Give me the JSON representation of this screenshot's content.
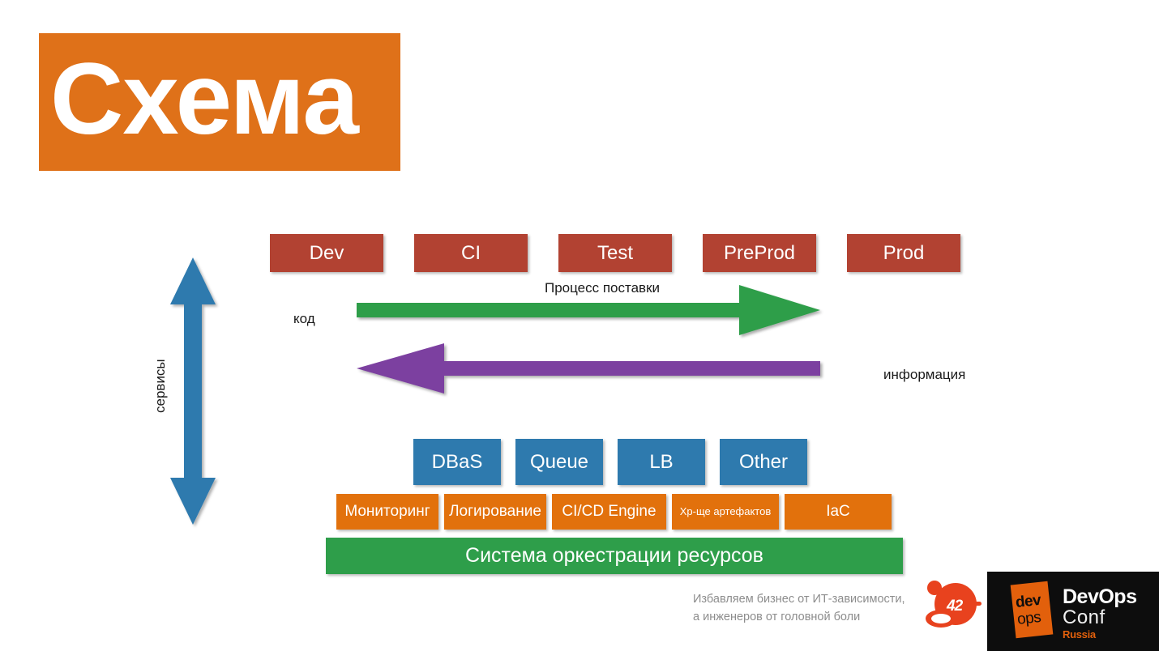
{
  "slide": {
    "title": "Схема",
    "title_bg": "#DF7119"
  },
  "pipeline": {
    "label_process": "Процесс поставки",
    "label_code": "код",
    "label_info": "информация",
    "label_services": "сервисы",
    "stages": [
      {
        "label": "Dev"
      },
      {
        "label": "CI"
      },
      {
        "label": "Test"
      },
      {
        "label": "PreProd"
      },
      {
        "label": "Prod"
      }
    ],
    "stage_color": "#B24232",
    "arrow_forward_color": "#2E9E4A",
    "arrow_backward_color": "#7B3FA0",
    "arrow_services_color": "#2E7AAE"
  },
  "platform": {
    "services": [
      {
        "label": "DBaS"
      },
      {
        "label": "Queue"
      },
      {
        "label": "LB"
      },
      {
        "label": "Other"
      }
    ],
    "services_color": "#2E7AAE",
    "tools": [
      {
        "label": "Мониторинг",
        "small": false
      },
      {
        "label": "Логирование",
        "small": false
      },
      {
        "label": "CI/CD Engine",
        "small": false
      },
      {
        "label": "Хр-ще артефактов",
        "small": true
      },
      {
        "label": "IaC",
        "small": false
      }
    ],
    "tools_color": "#E2710C",
    "orchestrator": "Система оркестрации ресурсов",
    "orchestrator_color": "#2E9E4A"
  },
  "footer": {
    "tagline_line1": "Избавляем бизнес от ИТ-зависимости,",
    "tagline_line2": "а инженеров от головной боли",
    "logo_number": "42",
    "logo_number_color": "#E8421E",
    "conf_dev": "dev",
    "conf_ops": "ops",
    "conf_name": "DevOps",
    "conf_kind": "Conf",
    "conf_region": "Russia",
    "conf_accent": "#E2600C"
  }
}
